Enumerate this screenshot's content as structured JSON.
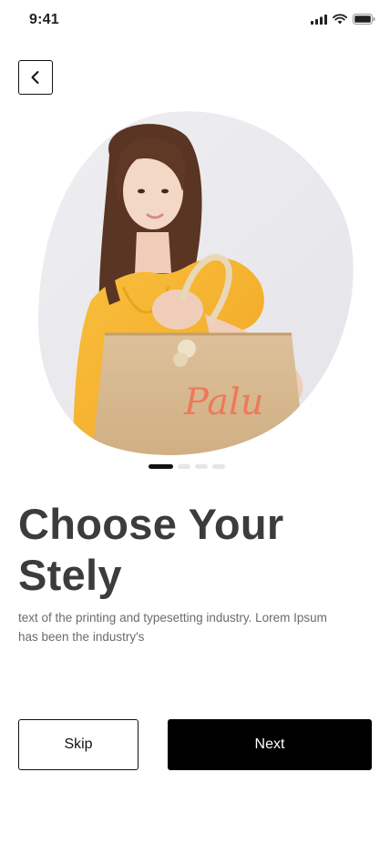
{
  "status_bar": {
    "time": "9:41",
    "icons": [
      "signal-icon",
      "wifi-icon",
      "battery-icon"
    ]
  },
  "nav": {
    "back_icon": "chevron-left-icon"
  },
  "hero": {
    "image_subject": "model-with-tote-bag",
    "bag_text": "Palu"
  },
  "pager": {
    "total": 4,
    "active_index": 0
  },
  "content": {
    "headline": "Choose Your Stely",
    "description": "text of the printing and typesetting industry. Lorem Ipsum has been the industry's"
  },
  "actions": {
    "skip_label": "Skip",
    "next_label": "Next"
  },
  "colors": {
    "primary": "#000000",
    "text": "#3c3c3c",
    "muted_text": "#6b6b6b",
    "blob_bg": "#ececf0",
    "dress": "#f6b530",
    "bag": "#d8b78d",
    "bag_text": "#ec7a5a"
  }
}
